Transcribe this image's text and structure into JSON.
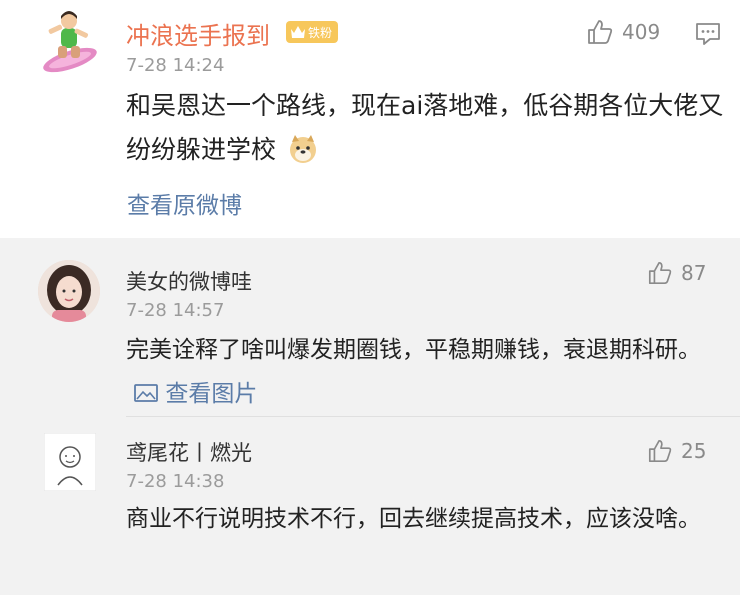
{
  "main_comment": {
    "username": "冲浪选手报到",
    "badge_label": "铁粉",
    "timestamp": "7-28 14:24",
    "likes": "409",
    "text": "和吴恩达一个路线，现在ai落地难，低谷期各位大佬又纷纷躲进学校",
    "emoji": "doge-emoji",
    "view_original_label": "查看原微博"
  },
  "replies": [
    {
      "username": "美女的微博哇",
      "timestamp": "7-28 14:57",
      "likes": "87",
      "text": "完美诠释了啥叫爆发期圈钱，平稳期赚钱，衰退期科研。",
      "view_image_label": "查看图片"
    },
    {
      "username": "鸢尾花丨燃光",
      "timestamp": "7-28 14:38",
      "likes": "25",
      "text": "商业不行说明技术不行，回去继续提高技术，应该没啥。"
    }
  ],
  "colors": {
    "username_orange": "#eb7350",
    "link_blue": "#5b7ca8",
    "reply_bg": "#f2f2f2",
    "badge_gold": "#f7c75b"
  }
}
